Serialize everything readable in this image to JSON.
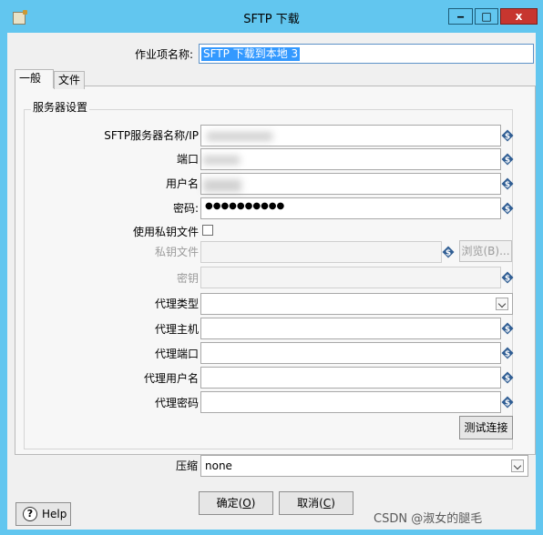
{
  "window": {
    "title": "SFTP 下载",
    "minimize_glyph": "‒",
    "maximize_glyph": "□",
    "close_glyph": "x"
  },
  "job_name": {
    "label": "作业项名称:",
    "value": "SFTP 下载到本地 3"
  },
  "tabs": [
    {
      "label": "一般"
    },
    {
      "label": "文件"
    }
  ],
  "server_group": {
    "title": "服务器设置",
    "fields": {
      "server": {
        "label": "SFTP服务器名称/IP"
      },
      "port": {
        "label": "端口"
      },
      "username": {
        "label": "用户名"
      },
      "password": {
        "label": "密码:",
        "value": "●●●●●●●●●●"
      },
      "use_key": {
        "label": "使用私钥文件"
      },
      "key_file": {
        "label": "私钥文件",
        "browse": "浏览(B)..."
      },
      "key_pass": {
        "label": "密钥"
      },
      "proxy_type": {
        "label": "代理类型"
      },
      "proxy_host": {
        "label": "代理主机"
      },
      "proxy_port": {
        "label": "代理端口"
      },
      "proxy_user": {
        "label": "代理用户名"
      },
      "proxy_pass": {
        "label": "代理密码"
      }
    },
    "test_button": "测试连接"
  },
  "compression": {
    "label": "压缩",
    "value": "none"
  },
  "buttons": {
    "ok_label": "确定(",
    "ok_key": "O",
    "cancel_label": "取消(",
    "cancel_key": "C",
    "close_paren": ")"
  },
  "help": {
    "icon": "?",
    "label": "Help"
  },
  "watermark": "CSDN @淑女的腿毛",
  "colors": {
    "title_bar": "#62c6ef",
    "close_button": "#c7362f",
    "variable_icon": "#2f5d93",
    "selection": "#3399ff"
  },
  "icons": {
    "variable": "dollar-variable-icon"
  }
}
